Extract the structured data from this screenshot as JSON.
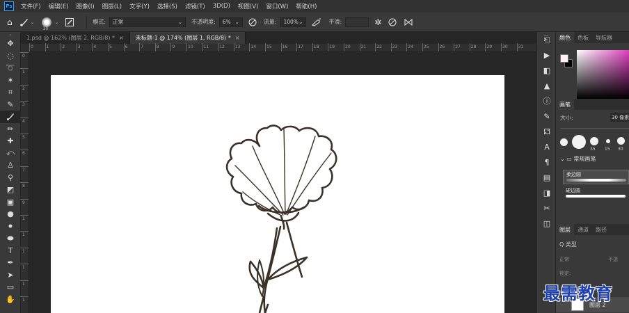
{
  "app": {
    "logo": "Ps"
  },
  "menu": [
    "文件(F)",
    "编辑(E)",
    "图像(I)",
    "图层(L)",
    "文字(Y)",
    "选择(S)",
    "滤镜(T)",
    "3D(D)",
    "视图(V)",
    "窗口(W)",
    "帮助(H)"
  ],
  "options": {
    "brush_size": "30",
    "mode_label": "模式:",
    "mode_value": "正常",
    "opacity_label": "不透明度:",
    "opacity_value": "6%",
    "flow_label": "流量:",
    "flow_value": "100%",
    "smoothing_label": "平滑:",
    "smoothing_value": ""
  },
  "tabs": [
    {
      "label": "1.psd @ 162% (图层 2, RGB/8) *",
      "close": "×"
    },
    {
      "label": "未标题-1 @ 174% (图层 1, RGB/8) *",
      "close": "×"
    }
  ],
  "ruler": {
    "h_ticks": [
      "0",
      "1",
      "2",
      "3",
      "4",
      "5",
      "6",
      "7",
      "8",
      "9",
      "10",
      "11",
      "12",
      "13",
      "14",
      "15",
      "16",
      "17",
      "18",
      "19",
      "20",
      "21",
      "22",
      "23",
      "24",
      "25",
      "26",
      "27",
      "28",
      "29",
      "30",
      "31"
    ],
    "v_ticks": [
      "0",
      "1",
      "2",
      "3",
      "4",
      "5",
      "6",
      "7",
      "8",
      "9",
      "1",
      "1",
      "1",
      "1",
      "1",
      "1"
    ]
  },
  "color_panel": {
    "tabs": [
      "颜色",
      "色板",
      "导航器"
    ],
    "fg": "#fff0f8",
    "bg": "#000000"
  },
  "brush_panel": {
    "title": "画笔",
    "size_label": "大小:",
    "size_value": "30 像素",
    "tips": [
      "35",
      "15",
      "30"
    ],
    "folder": "常规画笔",
    "brushes": [
      "柔边圆",
      "硬边圆"
    ]
  },
  "layers_panel": {
    "tabs": [
      "图层",
      "通道",
      "路径"
    ],
    "filter_label": "Q 类型",
    "blend_mode": "正常",
    "opacity_label": "不透",
    "lock_label": "锁定:",
    "layer_name": "图层 2"
  },
  "watermark": "最需教育"
}
